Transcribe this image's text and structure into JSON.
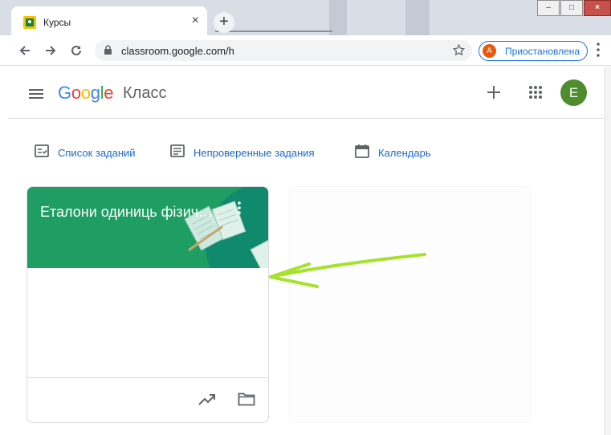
{
  "browser": {
    "tab_title": "Курсы",
    "tab_close": "×",
    "new_tab": "+",
    "url": "classroom.google.com/h",
    "profile_initial": "A",
    "profile_label": "Приостановлена",
    "window_min": "–",
    "window_max": "□",
    "window_close": "×"
  },
  "header": {
    "logo_letters": [
      "G",
      "o",
      "o",
      "g",
      "l",
      "e"
    ],
    "logo_colors": [
      "#4285f4",
      "#ea4335",
      "#fbbc05",
      "#4285f4",
      "#34a853",
      "#ea4335"
    ],
    "product": "Класс",
    "avatar_initial": "E"
  },
  "quicklinks": [
    {
      "label": "Список заданий",
      "icon": "assignment-list-icon"
    },
    {
      "label": "Непроверенные задания",
      "icon": "review-inbox-icon"
    },
    {
      "label": "Календарь",
      "icon": "calendar-icon"
    }
  ],
  "courses": [
    {
      "title": "Еталони одиниць фізичних величин",
      "banner_color": "#1f9e64"
    }
  ],
  "colors": {
    "accent": "#1a73e8",
    "link": "#1967d2",
    "annotation": "#a6e22a"
  }
}
